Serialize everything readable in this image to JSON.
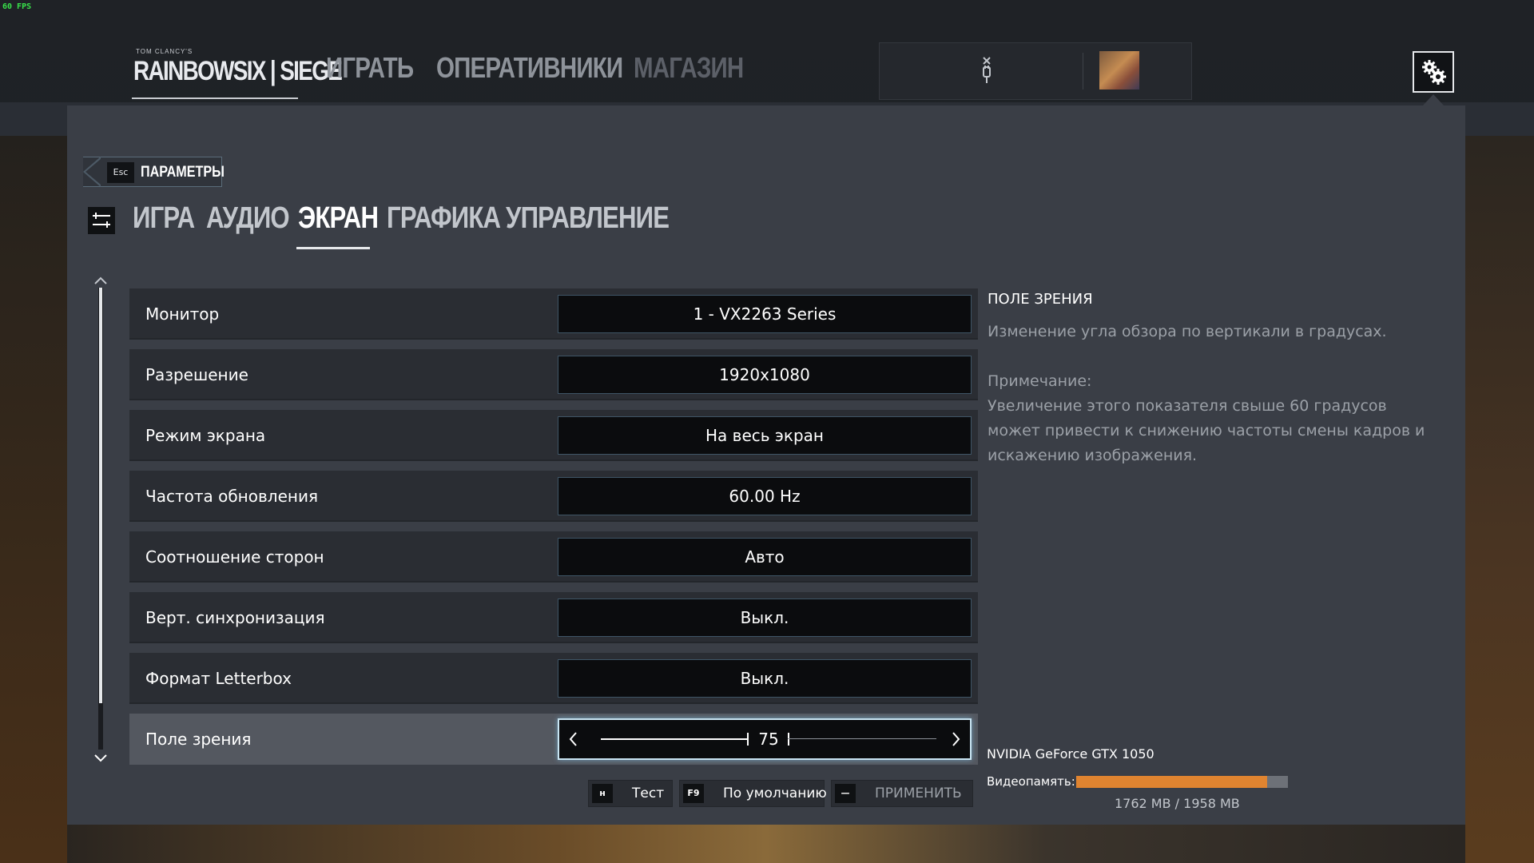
{
  "overlay": {
    "fps": "60 FPS"
  },
  "header": {
    "logo": {
      "small": "TOM CLANCY'S",
      "main": "RAINBOWSIX | SIEGE"
    },
    "nav": [
      {
        "label": "ИГРАТЬ"
      },
      {
        "label": "ОПЕРАТИВНИКИ"
      },
      {
        "label": "МАГАЗИН"
      }
    ],
    "icons": {
      "connection": "plug-icon",
      "settings": "gear-icon",
      "avatar": "avatar"
    }
  },
  "settings": {
    "back": {
      "key": "Esc",
      "label": "ПАРАМЕТРЫ"
    },
    "tabs": [
      {
        "label": "ИГРА"
      },
      {
        "label": "АУДИО"
      },
      {
        "label": "ЭКРАН",
        "active": true
      },
      {
        "label": "ГРАФИКА"
      },
      {
        "label": "УПРАВЛЕНИЕ"
      }
    ],
    "rows": [
      {
        "label": "Монитор",
        "value": "1 - VX2263 Series"
      },
      {
        "label": "Разрешение",
        "value": "1920x1080"
      },
      {
        "label": "Режим экрана",
        "value": "На весь экран"
      },
      {
        "label": "Частота обновления",
        "value": "60.00 Hz"
      },
      {
        "label": "Соотношение сторон",
        "value": "Авто"
      },
      {
        "label": "Верт. синхронизация",
        "value": "Выкл."
      },
      {
        "label": "Формат Letterbox",
        "value": "Выкл."
      },
      {
        "label": "Поле зрения",
        "value": "75",
        "slider_fraction": 0.47,
        "active": true
      }
    ],
    "footer": {
      "test": {
        "key": "н",
        "label": "Тест"
      },
      "default": {
        "key": "F9",
        "label": "По умолчанию"
      },
      "apply": {
        "key": "—",
        "label": "ПРИМЕНИТЬ"
      }
    }
  },
  "info": {
    "title": "ПОЛЕ ЗРЕНИЯ",
    "description": "Изменение угла обзора по вертикали в градусах.",
    "note_title": "Примечание:",
    "note": "Увеличение этого показателя свыше 60 градусов может привести к снижению частоты смены кадров и искажению изображения."
  },
  "gpu": {
    "name": "NVIDIA GeForce GTX 1050",
    "vram_label": "Видеопамять:",
    "vram_text": "1762 MB / 1958 MB",
    "vram_used_fraction": 0.9,
    "vram_color": "#e08430"
  },
  "colors": {
    "panel": "#3a3e46",
    "row": "#2a2d33",
    "row_active": "#545860",
    "value_box": "#0b0c0e",
    "focus_glow": "#c8e4f2"
  }
}
